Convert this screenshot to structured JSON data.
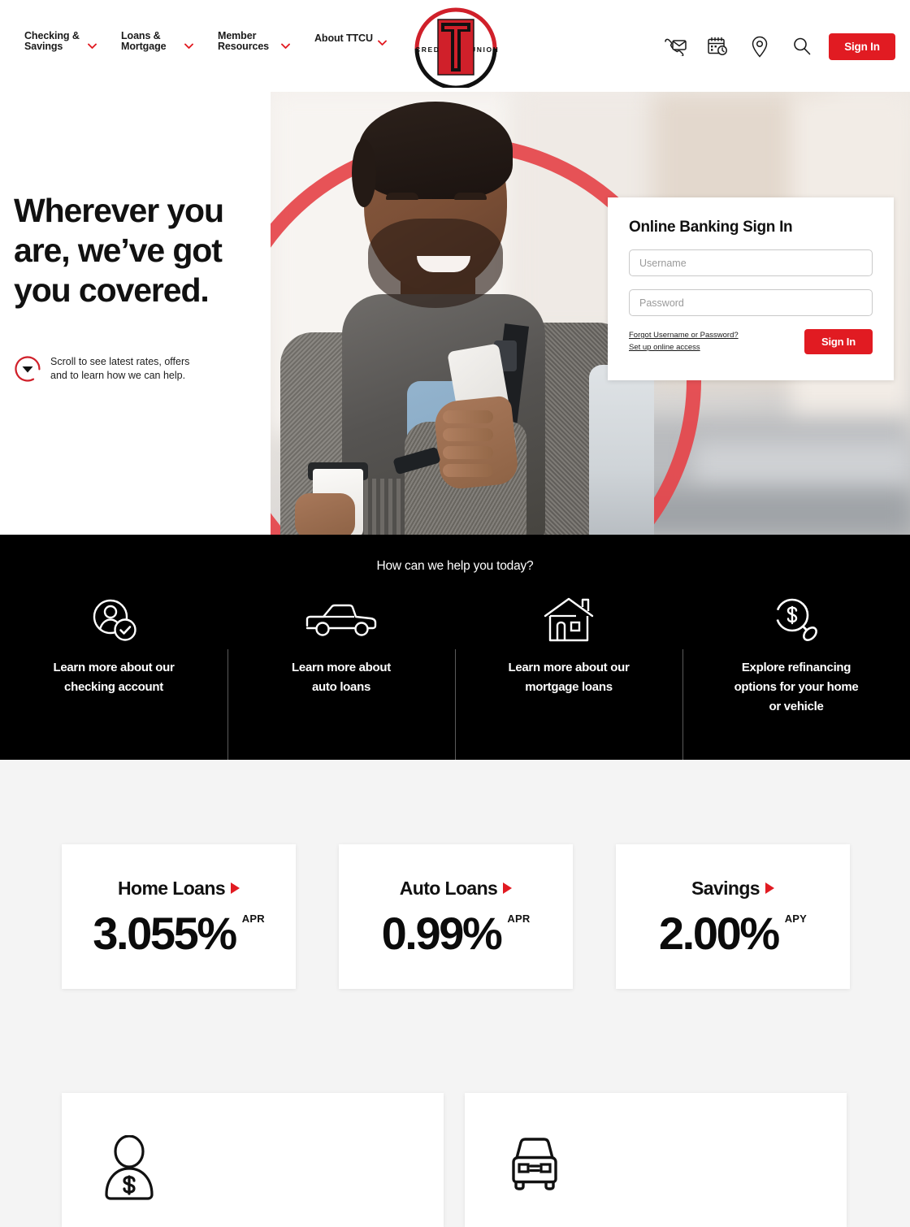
{
  "header": {
    "nav": [
      {
        "label": "Checking & Savings",
        "icon": "chevron-down-icon"
      },
      {
        "label": "Loans & Mortgage",
        "icon": "chevron-down-icon"
      },
      {
        "label": "Member Resources",
        "icon": "chevron-down-icon"
      },
      {
        "label": "About TTCU",
        "icon": "chevron-down-icon"
      }
    ],
    "logo": {
      "left_text": "CREDIT",
      "right_text": "UNION",
      "mark": "double-t-logo"
    },
    "icons": [
      {
        "name": "contact-icon"
      },
      {
        "name": "appointment-calendar-icon"
      },
      {
        "name": "location-pin-icon"
      },
      {
        "name": "search-icon"
      }
    ],
    "sign_in_label": "Sign In"
  },
  "hero": {
    "headline": "Wherever you are, we’ve got you covered.",
    "scroll_text": "Scroll to see latest rates, offers and to learn how we can help.",
    "scroll_icon": "chevron-down-circle-icon",
    "signin_card": {
      "title": "Online Banking Sign In",
      "username_placeholder": "Username",
      "username_value": "",
      "password_placeholder": "Password",
      "password_value": "",
      "forgot_link": "Forgot Username or Password?",
      "setup_link": "Set up online access",
      "button_label": "Sign In"
    }
  },
  "band": {
    "title": "How can we help you today?",
    "items": [
      {
        "label": "Learn more about our checking account",
        "icon": "person-check-icon"
      },
      {
        "label": "Learn more about auto loans",
        "icon": "car-side-icon"
      },
      {
        "label": "Learn more about our mortgage loans",
        "icon": "house-icon"
      },
      {
        "label": "Explore refinancing options for your home or vehicle",
        "icon": "magnifier-dollar-icon"
      }
    ]
  },
  "rates": [
    {
      "title": "Home Loans",
      "value": "3.055%",
      "sup": "APR",
      "arrow": "play-arrow-icon"
    },
    {
      "title": "Auto Loans",
      "value": "0.99%",
      "sup": "APR",
      "arrow": "play-arrow-icon"
    },
    {
      "title": "Savings",
      "value": "2.00%",
      "sup": "APY",
      "arrow": "play-arrow-icon"
    }
  ],
  "bottom_cards": [
    {
      "icon": "person-dollar-icon"
    },
    {
      "icon": "car-front-icon"
    }
  ],
  "colors": {
    "brand_red": "#E11B22",
    "ring_red": "#E5444A",
    "band_black": "#000000",
    "light_bg": "#f4f4f4"
  }
}
